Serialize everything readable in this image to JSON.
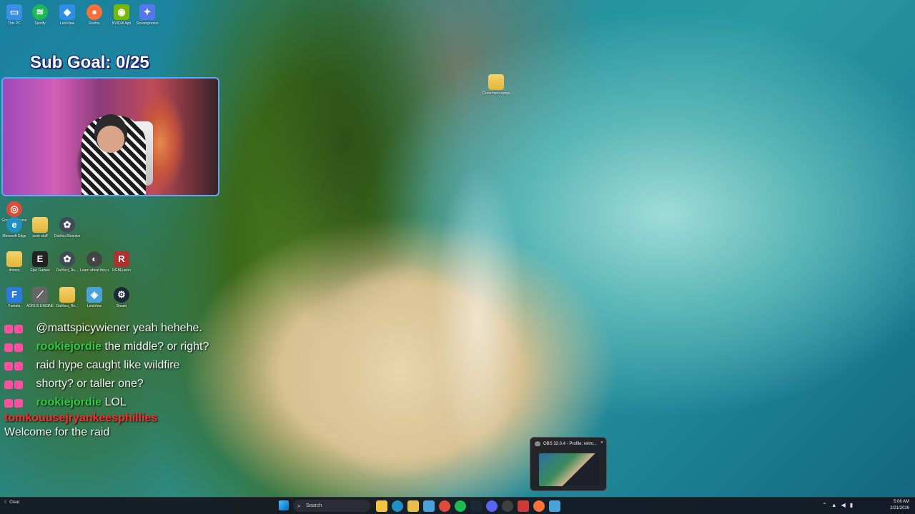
{
  "overlay": {
    "sub_goal": "Sub Goal: 0/25"
  },
  "desktop_icons": [
    {
      "label": "This PC",
      "icon": "pc-icon",
      "color": "#3a8ee6"
    },
    {
      "label": "Spotify",
      "icon": "spotify-icon",
      "color": "#1db954"
    },
    {
      "label": "LetsView",
      "icon": "letsview-icon",
      "color": "#2e8ee6"
    },
    {
      "label": "Firefox",
      "icon": "firefox-icon",
      "color": "#ff7139"
    },
    {
      "label": "NVIDIA App",
      "icon": "nvidia-icon",
      "color": "#76b900"
    },
    {
      "label": "Screenpresso",
      "icon": "screenpresso-icon",
      "color": "#5577ee"
    },
    {
      "label": "Google Chrome",
      "icon": "chrome-icon",
      "color": "#e04a3a"
    },
    {
      "label": "Microsoft Edge",
      "icon": "edge-icon",
      "color": "#1e90c8"
    },
    {
      "label": "work stuff",
      "icon": "folder-icon",
      "color": "#e9bf4c"
    },
    {
      "label": "DaVinci Resolve",
      "icon": "davinci-icon",
      "color": "#404a58"
    },
    {
      "label": "drivers",
      "icon": "folder-icon",
      "color": "#e9bf4c"
    },
    {
      "label": "Epic Games",
      "icon": "epic-icon",
      "color": "#222222"
    },
    {
      "label": "DaVinci_Re...",
      "icon": "davinci-icon",
      "color": "#404a58"
    },
    {
      "label": "Learn about this picture",
      "icon": "learn-icon",
      "color": "#444444"
    },
    {
      "label": "RGBFusion",
      "icon": "rgbfusion-icon",
      "color": "#b03030"
    },
    {
      "label": "Fortnite",
      "icon": "fortnite-icon",
      "color": "#2a7ae0"
    },
    {
      "label": "AORUS ENGINE",
      "icon": "aorus-icon",
      "color": "#666666"
    },
    {
      "label": "DaVinci_Re...",
      "icon": "folder-icon",
      "color": "#e9bf4c"
    },
    {
      "label": "LetsView",
      "icon": "letsview-icon",
      "color": "#4aa3d8"
    },
    {
      "label": "Steam",
      "icon": "steam-icon",
      "color": "#1b2838"
    },
    {
      "label": "Clone hero songs",
      "icon": "folder-icon",
      "color": "#e9bf4c"
    }
  ],
  "chat": [
    {
      "user": "",
      "text": "@mattspicywiener yeah hehehe.",
      "user_color": "#2ecc40"
    },
    {
      "user": "rookiejordie",
      "text": "the middle? or right?",
      "user_color": "#2ecc40"
    },
    {
      "user": "",
      "text": "raid hype caught like wildfire",
      "user_color": "#2ecc40"
    },
    {
      "user": "",
      "text": "shorty? or taller one?",
      "user_color": "#2ecc40"
    },
    {
      "user": "rookiejordie",
      "text": "LOL",
      "user_color": "#2ecc40"
    },
    {
      "user": "tomkouusejryankeesphillies",
      "text": "Welcome for the raid",
      "user_color": "#ff2f2f"
    }
  ],
  "obs_preview": {
    "title": "OBS 32.0.4 - Profile: relim...",
    "close": "×"
  },
  "taskbar": {
    "weather": "Clear",
    "search_placeholder": "Search",
    "time": "5:06 AM",
    "date": "2/21/2026",
    "apps": [
      {
        "name": "file-explorer",
        "color": "#f5c542"
      },
      {
        "name": "edge",
        "color": "#1e90c8"
      },
      {
        "name": "folder",
        "color": "#e9bf4c"
      },
      {
        "name": "store",
        "color": "#4aa3d8"
      },
      {
        "name": "chrome",
        "color": "#e04a3a"
      },
      {
        "name": "spotify",
        "color": "#1db954"
      },
      {
        "name": "steam",
        "color": "#1b2838"
      },
      {
        "name": "discord",
        "color": "#5865f2"
      },
      {
        "name": "obs",
        "color": "#404040"
      },
      {
        "name": "vivaldi",
        "color": "#cc3a3a"
      },
      {
        "name": "firefox",
        "color": "#ff7139"
      },
      {
        "name": "letsview",
        "color": "#4aa3d8"
      }
    ]
  }
}
